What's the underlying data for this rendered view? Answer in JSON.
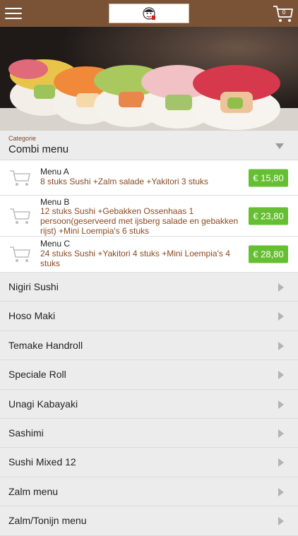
{
  "header": {
    "menu_icon": "hamburger-icon",
    "logo": "restaurant-logo",
    "cart_icon": "shopping-cart-icon",
    "cart_count": "0"
  },
  "hero": {
    "image": "sushi-rolls-photo"
  },
  "category": {
    "label": "Categorie",
    "selected": "Combi menu"
  },
  "menus": [
    {
      "title": "Menu A",
      "description": "8 stuks Sushi +Zalm salade +Yakitori 3 stuks",
      "price": "€ 15,80"
    },
    {
      "title": "Menu B",
      "description": "12 stuks Sushi +Gebakken Ossenhaas 1 persoon(geserveerd met ijsberg salade en gebakken rijst) +Mini Loempia's 6 stuks",
      "price": "€ 23,80"
    },
    {
      "title": "Menu C",
      "description": "24 stuks Sushi +Yakitori 4 stuks +Mini Loempia's 4 stuks",
      "price": "€ 28,80"
    }
  ],
  "categories": [
    "Nigiri Sushi",
    "Hoso Maki",
    "Temake Handroll",
    "Speciale Roll",
    "Unagi Kabayaki",
    "Sashimi",
    "Sushi Mixed 12",
    "Zalm menu",
    "Zalm/Tonijn menu"
  ],
  "colors": {
    "header_bg": "#7a5235",
    "price_green": "#66bf33",
    "desc_brown": "#8a4a23"
  }
}
